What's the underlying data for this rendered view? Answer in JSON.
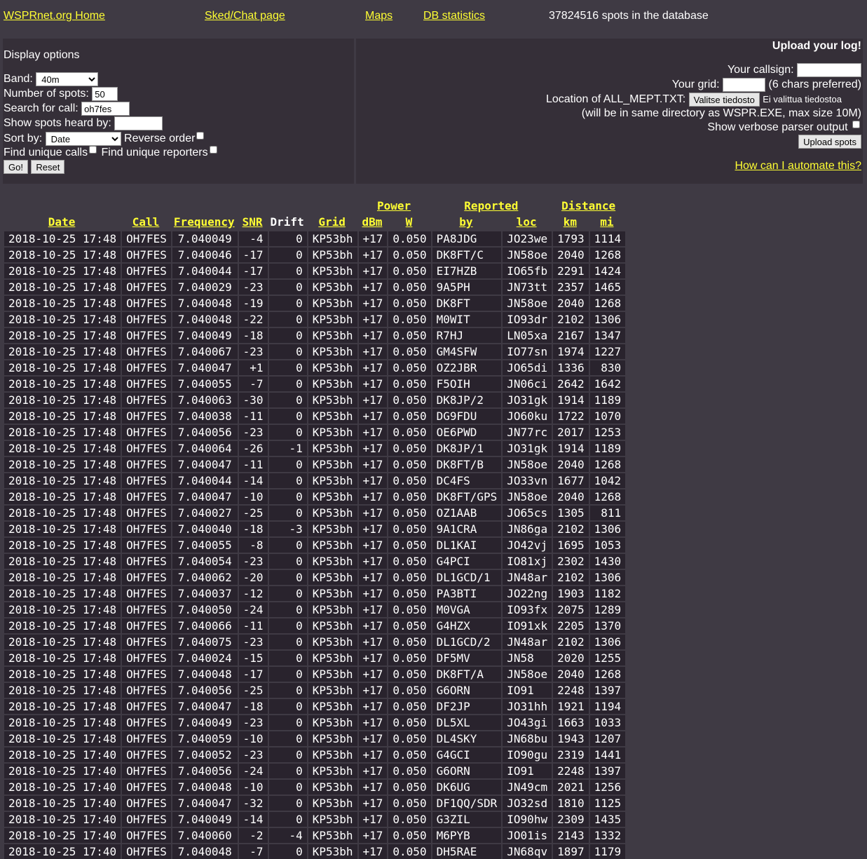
{
  "nav": {
    "home": "WSPRnet.org Home",
    "sked": "Sked/Chat page",
    "maps": "Maps",
    "dbstats": "DB statistics",
    "spot_count": "37824516 spots in the database"
  },
  "display": {
    "title": "Display options",
    "band_label": "Band:",
    "band_value": "40m",
    "num_spots_label": "Number of spots:",
    "num_spots_value": "50",
    "search_call_label": "Search for call:",
    "search_call_value": "oh7fes",
    "heard_by_label": "Show spots heard by:",
    "heard_by_value": "",
    "sort_label": "Sort by:",
    "sort_value": "Date",
    "reverse_label": "Reverse order",
    "unique_calls_label": "Find unique calls",
    "unique_reporters_label": "Find unique reporters",
    "go_label": "Go!",
    "reset_label": "Reset"
  },
  "upload": {
    "title": "Upload your log!",
    "callsign_label": "Your callsign:",
    "grid_label": "Your grid:",
    "grid_hint": "(6 chars preferred)",
    "location_label": "Location of ALL_MEPT.TXT:",
    "file_button": "Valitse tiedosto",
    "file_status": "Ei valittua tiedostoa",
    "note": "(will be in same directory as WSPR.EXE, max size 10M)",
    "verbose_label": "Show verbose parser output",
    "upload_button": "Upload spots",
    "automate_link": "How can I automate this?"
  },
  "table": {
    "group_power": "Power",
    "group_reported": "Reported",
    "group_distance": "Distance",
    "headers": [
      "Date",
      "Call",
      "Frequency",
      "SNR",
      "Drift",
      "Grid",
      "dBm",
      "W",
      "by",
      "loc",
      "km",
      "mi"
    ],
    "rows": [
      [
        "2018-10-25 17:48",
        "OH7FES",
        "7.040049",
        "-4",
        "0",
        "KP53bh",
        "+17",
        "0.050",
        "PA8JDG",
        "JO23we",
        "1793",
        "1114"
      ],
      [
        "2018-10-25 17:48",
        "OH7FES",
        "7.040046",
        "-17",
        "0",
        "KP53bh",
        "+17",
        "0.050",
        "DK8FT/C",
        "JN58oe",
        "2040",
        "1268"
      ],
      [
        "2018-10-25 17:48",
        "OH7FES",
        "7.040044",
        "-17",
        "0",
        "KP53bh",
        "+17",
        "0.050",
        "EI7HZB",
        "IO65fb",
        "2291",
        "1424"
      ],
      [
        "2018-10-25 17:48",
        "OH7FES",
        "7.040029",
        "-23",
        "0",
        "KP53bh",
        "+17",
        "0.050",
        "9A5PH",
        "JN73tt",
        "2357",
        "1465"
      ],
      [
        "2018-10-25 17:48",
        "OH7FES",
        "7.040048",
        "-19",
        "0",
        "KP53bh",
        "+17",
        "0.050",
        "DK8FT",
        "JN58oe",
        "2040",
        "1268"
      ],
      [
        "2018-10-25 17:48",
        "OH7FES",
        "7.040048",
        "-22",
        "0",
        "KP53bh",
        "+17",
        "0.050",
        "M0WIT",
        "IO93dr",
        "2102",
        "1306"
      ],
      [
        "2018-10-25 17:48",
        "OH7FES",
        "7.040049",
        "-18",
        "0",
        "KP53bh",
        "+17",
        "0.050",
        "R7HJ",
        "LN05xa",
        "2167",
        "1347"
      ],
      [
        "2018-10-25 17:48",
        "OH7FES",
        "7.040067",
        "-23",
        "0",
        "KP53bh",
        "+17",
        "0.050",
        "GM4SFW",
        "IO77sn",
        "1974",
        "1227"
      ],
      [
        "2018-10-25 17:48",
        "OH7FES",
        "7.040047",
        "+1",
        "0",
        "KP53bh",
        "+17",
        "0.050",
        "OZ2JBR",
        "JO65di",
        "1336",
        "830"
      ],
      [
        "2018-10-25 17:48",
        "OH7FES",
        "7.040055",
        "-7",
        "0",
        "KP53bh",
        "+17",
        "0.050",
        "F5OIH",
        "JN06ci",
        "2642",
        "1642"
      ],
      [
        "2018-10-25 17:48",
        "OH7FES",
        "7.040063",
        "-30",
        "0",
        "KP53bh",
        "+17",
        "0.050",
        "DK8JP/2",
        "JO31gk",
        "1914",
        "1189"
      ],
      [
        "2018-10-25 17:48",
        "OH7FES",
        "7.040038",
        "-11",
        "0",
        "KP53bh",
        "+17",
        "0.050",
        "DG9FDU",
        "JO60ku",
        "1722",
        "1070"
      ],
      [
        "2018-10-25 17:48",
        "OH7FES",
        "7.040056",
        "-23",
        "0",
        "KP53bh",
        "+17",
        "0.050",
        "OE6PWD",
        "JN77rc",
        "2017",
        "1253"
      ],
      [
        "2018-10-25 17:48",
        "OH7FES",
        "7.040064",
        "-26",
        "-1",
        "KP53bh",
        "+17",
        "0.050",
        "DK8JP/1",
        "JO31gk",
        "1914",
        "1189"
      ],
      [
        "2018-10-25 17:48",
        "OH7FES",
        "7.040047",
        "-11",
        "0",
        "KP53bh",
        "+17",
        "0.050",
        "DK8FT/B",
        "JN58oe",
        "2040",
        "1268"
      ],
      [
        "2018-10-25 17:48",
        "OH7FES",
        "7.040044",
        "-14",
        "0",
        "KP53bh",
        "+17",
        "0.050",
        "DC4FS",
        "JO33vn",
        "1677",
        "1042"
      ],
      [
        "2018-10-25 17:48",
        "OH7FES",
        "7.040047",
        "-10",
        "0",
        "KP53bh",
        "+17",
        "0.050",
        "DK8FT/GPS",
        "JN58oe",
        "2040",
        "1268"
      ],
      [
        "2018-10-25 17:48",
        "OH7FES",
        "7.040027",
        "-25",
        "0",
        "KP53bh",
        "+17",
        "0.050",
        "OZ1AAB",
        "JO65cs",
        "1305",
        "811"
      ],
      [
        "2018-10-25 17:48",
        "OH7FES",
        "7.040040",
        "-18",
        "-3",
        "KP53bh",
        "+17",
        "0.050",
        "9A1CRA",
        "JN86ga",
        "2102",
        "1306"
      ],
      [
        "2018-10-25 17:48",
        "OH7FES",
        "7.040055",
        "-8",
        "0",
        "KP53bh",
        "+17",
        "0.050",
        "DL1KAI",
        "JO42vj",
        "1695",
        "1053"
      ],
      [
        "2018-10-25 17:48",
        "OH7FES",
        "7.040054",
        "-23",
        "0",
        "KP53bh",
        "+17",
        "0.050",
        "G4PCI",
        "IO81xj",
        "2302",
        "1430"
      ],
      [
        "2018-10-25 17:48",
        "OH7FES",
        "7.040062",
        "-20",
        "0",
        "KP53bh",
        "+17",
        "0.050",
        "DL1GCD/1",
        "JN48ar",
        "2102",
        "1306"
      ],
      [
        "2018-10-25 17:48",
        "OH7FES",
        "7.040037",
        "-12",
        "0",
        "KP53bh",
        "+17",
        "0.050",
        "PA3BTI",
        "JO22ng",
        "1903",
        "1182"
      ],
      [
        "2018-10-25 17:48",
        "OH7FES",
        "7.040050",
        "-24",
        "0",
        "KP53bh",
        "+17",
        "0.050",
        "M0VGA",
        "IO93fx",
        "2075",
        "1289"
      ],
      [
        "2018-10-25 17:48",
        "OH7FES",
        "7.040066",
        "-11",
        "0",
        "KP53bh",
        "+17",
        "0.050",
        "G4HZX",
        "IO91xk",
        "2205",
        "1370"
      ],
      [
        "2018-10-25 17:48",
        "OH7FES",
        "7.040075",
        "-23",
        "0",
        "KP53bh",
        "+17",
        "0.050",
        "DL1GCD/2",
        "JN48ar",
        "2102",
        "1306"
      ],
      [
        "2018-10-25 17:48",
        "OH7FES",
        "7.040024",
        "-15",
        "0",
        "KP53bh",
        "+17",
        "0.050",
        "DF5MV",
        "JN58",
        "2020",
        "1255"
      ],
      [
        "2018-10-25 17:48",
        "OH7FES",
        "7.040048",
        "-17",
        "0",
        "KP53bh",
        "+17",
        "0.050",
        "DK8FT/A",
        "JN58oe",
        "2040",
        "1268"
      ],
      [
        "2018-10-25 17:48",
        "OH7FES",
        "7.040056",
        "-25",
        "0",
        "KP53bh",
        "+17",
        "0.050",
        "G6ORN",
        "IO91",
        "2248",
        "1397"
      ],
      [
        "2018-10-25 17:48",
        "OH7FES",
        "7.040047",
        "-18",
        "0",
        "KP53bh",
        "+17",
        "0.050",
        "DF2JP",
        "JO31hh",
        "1921",
        "1194"
      ],
      [
        "2018-10-25 17:48",
        "OH7FES",
        "7.040049",
        "-23",
        "0",
        "KP53bh",
        "+17",
        "0.050",
        "DL5XL",
        "JO43gi",
        "1663",
        "1033"
      ],
      [
        "2018-10-25 17:48",
        "OH7FES",
        "7.040059",
        "-10",
        "0",
        "KP53bh",
        "+17",
        "0.050",
        "DL4SKY",
        "JN68bu",
        "1943",
        "1207"
      ],
      [
        "2018-10-25 17:40",
        "OH7FES",
        "7.040052",
        "-23",
        "0",
        "KP53bh",
        "+17",
        "0.050",
        "G4GCI",
        "IO90gu",
        "2319",
        "1441"
      ],
      [
        "2018-10-25 17:40",
        "OH7FES",
        "7.040056",
        "-24",
        "0",
        "KP53bh",
        "+17",
        "0.050",
        "G6ORN",
        "IO91",
        "2248",
        "1397"
      ],
      [
        "2018-10-25 17:40",
        "OH7FES",
        "7.040048",
        "-10",
        "0",
        "KP53bh",
        "+17",
        "0.050",
        "DK6UG",
        "JN49cm",
        "2021",
        "1256"
      ],
      [
        "2018-10-25 17:40",
        "OH7FES",
        "7.040047",
        "-32",
        "0",
        "KP53bh",
        "+17",
        "0.050",
        "DF1QQ/SDR",
        "JO32sd",
        "1810",
        "1125"
      ],
      [
        "2018-10-25 17:40",
        "OH7FES",
        "7.040049",
        "-14",
        "0",
        "KP53bh",
        "+17",
        "0.050",
        "G3ZIL",
        "IO90hw",
        "2309",
        "1435"
      ],
      [
        "2018-10-25 17:40",
        "OH7FES",
        "7.040060",
        "-2",
        "-4",
        "KP53bh",
        "+17",
        "0.050",
        "M6PYB",
        "JO01is",
        "2143",
        "1332"
      ],
      [
        "2018-10-25 17:40",
        "OH7FES",
        "7.040048",
        "-7",
        "0",
        "KP53bh",
        "+17",
        "0.050",
        "DH5RAE",
        "JN68qv",
        "1897",
        "1179"
      ]
    ]
  }
}
